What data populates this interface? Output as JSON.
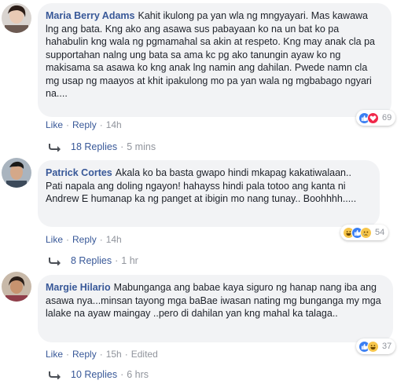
{
  "comments": [
    {
      "author": "Maria Berry Adams",
      "text": "Kahit ikulong pa yan wla ng mngyayari. Mas kawawa lng ang bata. Kng ako ang asawa sus pabayaan ko na un bat ko pa hahabulin kng wala ng pgmamahal sa akin at respeto. Kng may anak cla pa supportahan nalng ung bata sa ama kc pg ako tanungin ayaw ko ng makisama sa asawa ko kng anak lng namin ang dahilan. Pwede namn cla mg usap ng maayos at khit ipakulong mo pa yan wala ng mgbabago ngyari na....",
      "like_label": "Like",
      "reply_label": "Reply",
      "time": "14h",
      "edited": "",
      "reactions": [
        "like-icon",
        "heart-icon"
      ],
      "reaction_count": "69",
      "replies_label": "18 Replies",
      "replies_time": "5 mins"
    },
    {
      "author": "Patrick Cortes",
      "text": "Akala ko ba basta gwapo hindi mkapag kakatiwalaan.. Pati napala ang doling ngayon! hahayss hindi pala totoo ang kanta ni Andrew E humanap ka ng panget at ibigin mo nang tunay.. Boohhhh.....",
      "like_label": "Like",
      "reply_label": "Reply",
      "time": "14h",
      "edited": "",
      "reactions": [
        "haha-icon",
        "like-icon",
        "sad-icon"
      ],
      "reaction_count": "54",
      "replies_label": "8 Replies",
      "replies_time": "1 hr"
    },
    {
      "author": "Margie Hilario",
      "text": "Mabunganga ang babae kaya siguro ng hanap nang iba ang asawa nya...minsan tayong mga baBae iwasan nating mg bunganga my mga lalake na ayaw maingay ..pero di dahilan yan kng mahal ka talaga..",
      "like_label": "Like",
      "reply_label": "Reply",
      "time": "15h",
      "edited": "Edited",
      "reactions": [
        "like-icon",
        "haha-icon"
      ],
      "reaction_count": "37",
      "replies_label": "10 Replies",
      "replies_time": "6 hrs"
    }
  ],
  "colors": {
    "link": "#385898",
    "meta": "#90949c",
    "bubble": "#f2f3f5",
    "like": "#3b7ff2",
    "heart": "#f0284a",
    "haha": "#f7c64b"
  }
}
